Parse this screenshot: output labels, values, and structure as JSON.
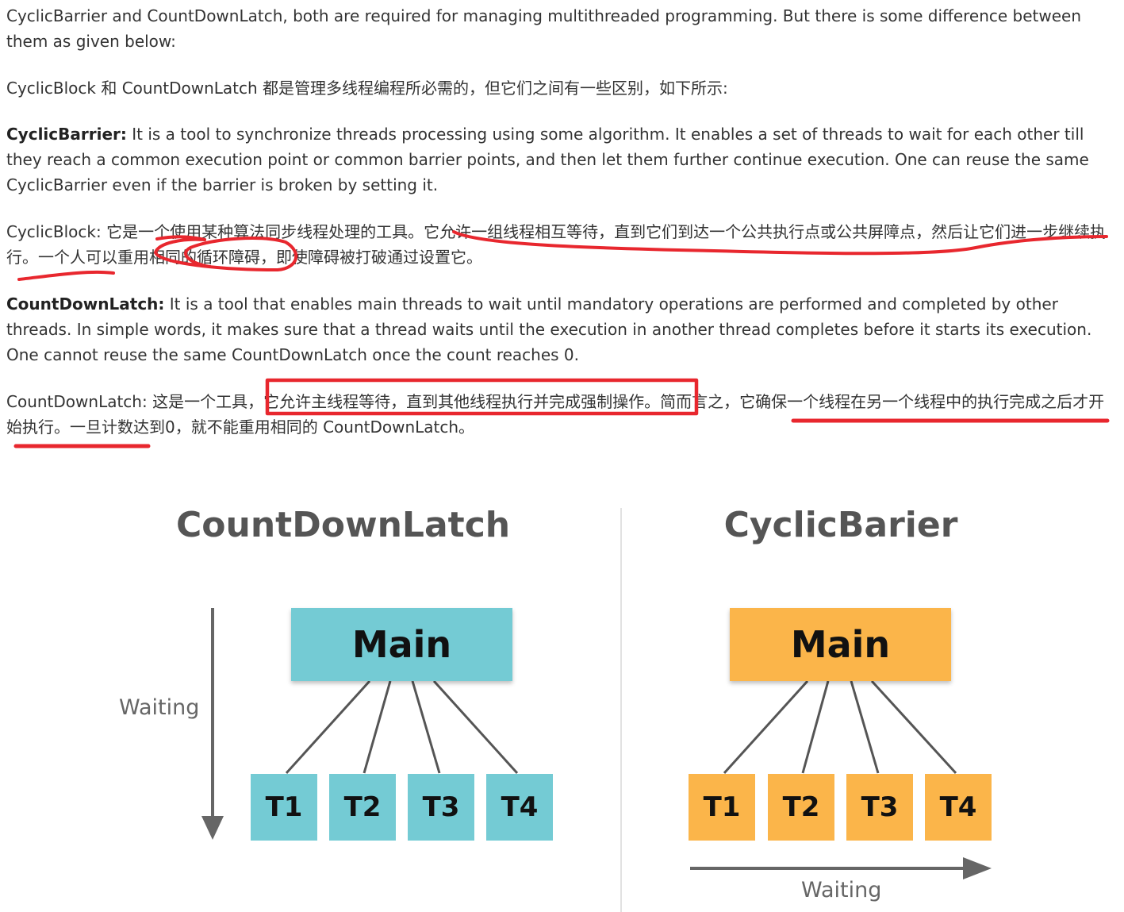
{
  "article": {
    "p1": "CyclicBarrier and CountDownLatch, both are required for managing multithreaded programming. But there is some difference between them as given below:",
    "p2": "CyclicBlock 和 CountDownLatch 都是管理多线程编程所必需的，但它们之间有一些区别，如下所示:",
    "p3_term": "CyclicBarrier:",
    "p3_text": " It is a tool to synchronize threads processing using some algorithm. It enables a set of threads to wait for each other till they reach a common execution point or common barrier points, and then let them further continue execution. One can reuse the same CyclicBarrier even if the barrier is broken by setting it.",
    "p4": "CyclicBlock: 它是一个使用某种算法同步线程处理的工具。它允许一组线程相互等待，直到它们到达一个公共执行点或公共屏障点，然后让它们进一步继续执行。一个人可以重用相同的循环障碍，即使障碍被打破通过设置它。",
    "p5_term": "CountDownLatch:",
    "p5_text": " It is a tool that enables main threads to wait until mandatory operations are performed and completed by other threads. In simple words, it makes sure that a thread waits until the execution in another thread completes before it starts its execution. One cannot reuse the same CountDownLatch once the count reaches 0.",
    "p6_a": "CountDownLatch: 这是一个工具，",
    "p6_boxed": "它允许主线程等待，直到其他线程执行并完成强制操作。",
    "p6_b": "简而言之，它确保一个线程在另一个线程中的执行完成之后才开始执行。一旦计数达到0，就不能重用相同的 CountDownLatch。"
  },
  "annotations": {
    "color": "#E8272E"
  },
  "diagrams": {
    "left": {
      "title": "CountDownLatch",
      "main": "Main",
      "threads": [
        "T1",
        "T2",
        "T3",
        "T4"
      ],
      "waiting": "Waiting",
      "color": "#74CBD4"
    },
    "right": {
      "title": "CyclicBarier",
      "main": "Main",
      "threads": [
        "T1",
        "T2",
        "T3",
        "T4"
      ],
      "waiting": "Waiting",
      "color": "#FBB54A"
    }
  }
}
